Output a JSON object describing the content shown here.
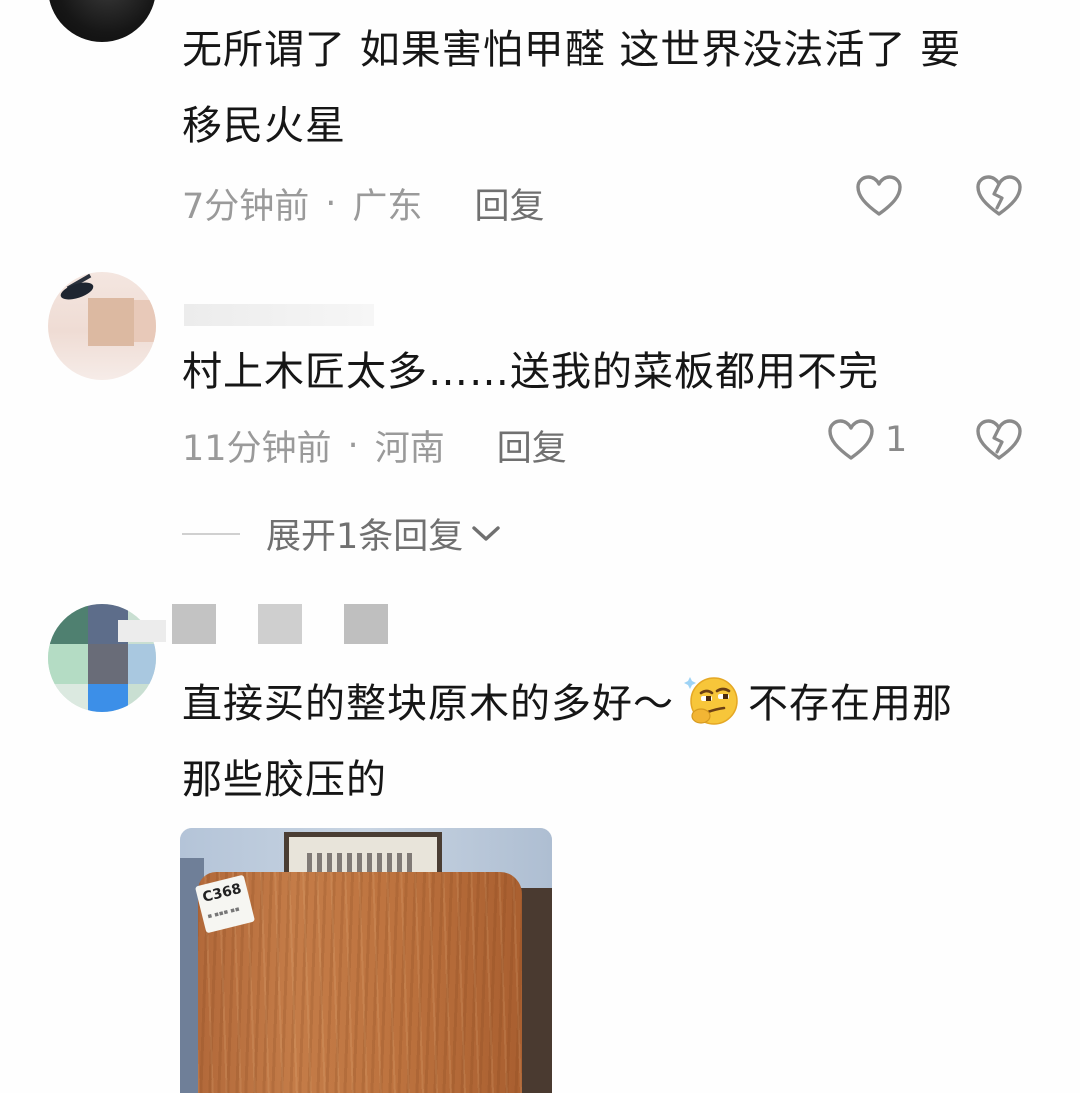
{
  "comments": [
    {
      "text_line1": "无所谓了 如果害怕甲醛 这世界没法活了 要",
      "text_line2": "移民火星",
      "time": "7分钟前",
      "location": "广东",
      "reply_label": "回复",
      "like_count": ""
    },
    {
      "text_line1": "村上木匠太多……送我的菜板都用不完",
      "time": "11分钟前",
      "location": "河南",
      "reply_label": "回复",
      "like_count": "1",
      "expand_label": "展开1条回复"
    },
    {
      "text_line1_before_emoji": "直接买的整块原木的多好～",
      "text_line1_after_emoji": "不存在用那",
      "text_line2": "那些胶压的",
      "emoji": "thinking-smirk-emoji",
      "photo_label": "C368"
    }
  ],
  "meta_separator": "·",
  "colors": {
    "background": "#fefefe",
    "text": "#161616",
    "meta": "#9a9a9a",
    "icon": "#8a8a8a"
  }
}
